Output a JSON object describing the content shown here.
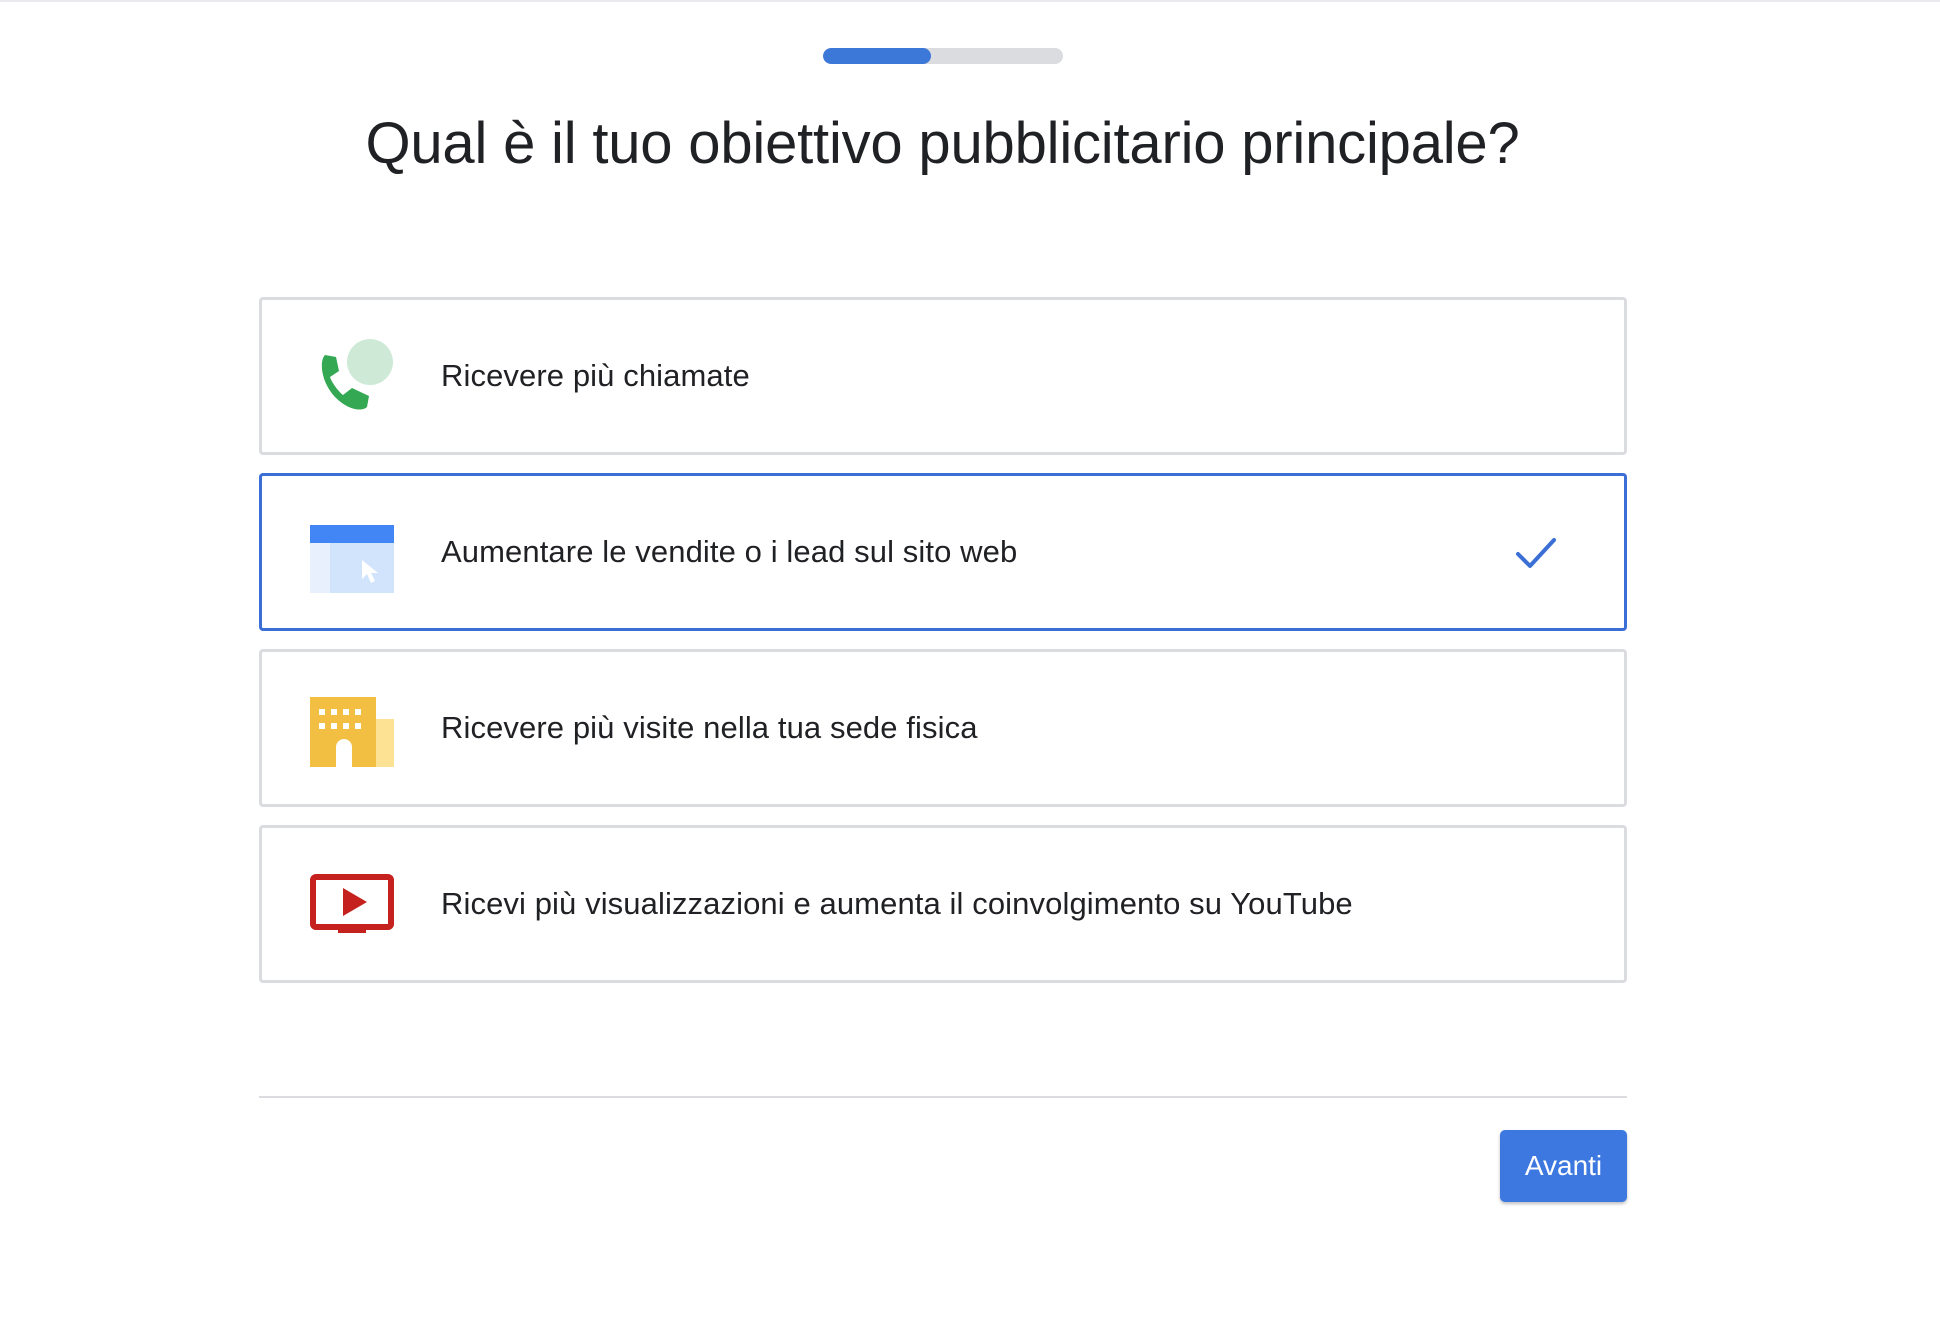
{
  "progress": {
    "fraction": 0.45
  },
  "title": "Qual è il tuo obiettivo pubblicitario principale?",
  "options": [
    {
      "label": "Ricevere più chiamate",
      "icon": "phone-chat-icon",
      "selected": false
    },
    {
      "label": "Aumentare le vendite o i lead sul sito web",
      "icon": "website-cursor-icon",
      "selected": true
    },
    {
      "label": "Ricevere più visite nella tua sede fisica",
      "icon": "store-building-icon",
      "selected": false
    },
    {
      "label": "Ricevi più visualizzazioni e aumenta il coinvolgimento su YouTube",
      "icon": "youtube-play-icon",
      "selected": false
    }
  ],
  "next_button": {
    "label": "Avanti"
  },
  "colors": {
    "accent": "#3c78e0",
    "selected_border": "#3c6fd6",
    "phone_green": "#34a853",
    "bubble_green": "#ceead6",
    "building_yellow": "#f2bf42",
    "youtube_red": "#c5221f"
  }
}
